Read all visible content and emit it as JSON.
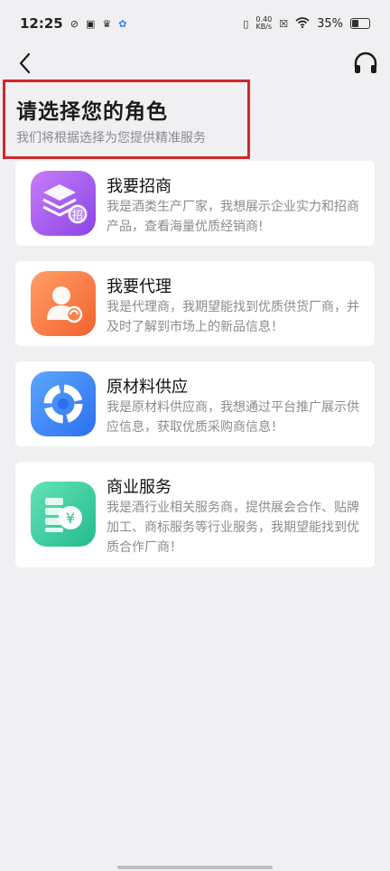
{
  "status_bar": {
    "time": "12:25",
    "net_speed_value": "0.40",
    "net_speed_unit": "KB/s",
    "battery": "35%"
  },
  "header": {
    "title": "请选择您的角色",
    "subtitle": "我们将根据选择为您提供精准服务"
  },
  "cards": [
    {
      "title": "我要招商",
      "desc": "我是酒类生产厂家，我想展示企业实力和招商产品，查看海量优质经销商!",
      "icon": "stack-layers-icon",
      "icon_badge": "招",
      "colors": [
        "#c079f5",
        "#8a45e6"
      ]
    },
    {
      "title": "我要代理",
      "desc": "我是代理商，我期望能找到优质供货厂商，并及时了解到市场上的新品信息！",
      "icon": "agent-person-icon",
      "colors": [
        "#ff9a62",
        "#f4612e"
      ]
    },
    {
      "title": "原材料供应",
      "desc": "我是原材料供应商，我想通过平台推广展示供应信息，获取优质采购商信息！",
      "icon": "supply-ring-icon",
      "colors": [
        "#5aa3ff",
        "#2d6ff0"
      ]
    },
    {
      "title": "商业服务",
      "desc": "我是酒行业相关服务商，提供展会合作、贴牌加工、商标服务等行业服务，我期望能找到优质合作厂商！",
      "icon": "money-service-icon",
      "colors": [
        "#5fe0b6",
        "#26bd8e"
      ]
    }
  ]
}
